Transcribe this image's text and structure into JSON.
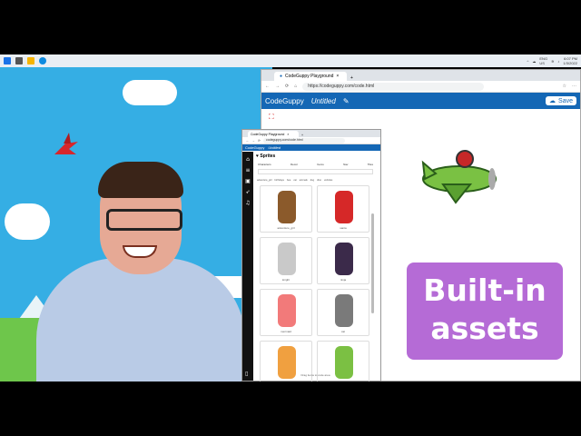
{
  "taskbar": {
    "tray_lang": "ENG",
    "tray_region": "US",
    "clock_time": "6:07 PM",
    "clock_date": "1/3/2022"
  },
  "big_browser": {
    "tab_title": "CodeGuppy Playground",
    "new_tab": "+",
    "url": "https://codeguppy.com/code.html",
    "app_name": "CodeGuppy",
    "project_name": "Untitled",
    "save_label": "Save"
  },
  "small_browser": {
    "tab_title": "CodeGuppy Playground",
    "url": "codeguppy.com/code.html",
    "app_name": "CodeGuppy",
    "project_name": "Untitled",
    "panel_title": "Sprites",
    "tabs": [
      "Characters",
      "Decor",
      "Items",
      "Nav",
      "Tiles"
    ],
    "filters": [
      "adventure_girl",
      "birthdays",
      "bee",
      "cat",
      "animals",
      "dog",
      "dino",
      "vehicles"
    ],
    "sprites": [
      {
        "label": "adventure_girl",
        "color": "#8b5a2b"
      },
      {
        "label": "santa",
        "color": "#d62828"
      },
      {
        "label": "knight",
        "color": "#c9c9c9"
      },
      {
        "label": "ninja",
        "color": "#3b2a4a"
      },
      {
        "label": "mermaid",
        "color": "#f27a7a"
      },
      {
        "label": "cat",
        "color": "#7a7a7a"
      },
      {
        "label": "",
        "color": "#f0a040"
      },
      {
        "label": "",
        "color": "#7bc043"
      }
    ],
    "footer": "Drag items to code area"
  },
  "overlay": {
    "line1": "Built-in",
    "line2": "assets"
  }
}
